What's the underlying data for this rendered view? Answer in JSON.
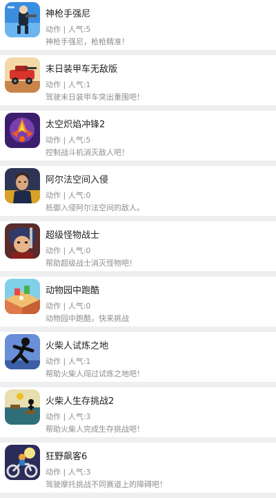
{
  "games": [
    {
      "title": "神枪手强尼",
      "category": "动作",
      "popularity_label": "人气",
      "popularity": "5",
      "description": "神枪手强尼，枪枪精准！",
      "icon": "gunslinger-game-icon"
    },
    {
      "title": "末日装甲车无敌版",
      "category": "动作",
      "popularity_label": "人气",
      "popularity": "1",
      "description": "驾驶末日装甲车突出重围吧！",
      "icon": "armored-car-game-icon"
    },
    {
      "title": "太空炽焰冲锋2",
      "category": "动作",
      "popularity_label": "人气",
      "popularity": "5",
      "description": "控制战斗机消灭敌人吧！",
      "icon": "space-fighter-game-icon"
    },
    {
      "title": "阿尔法空间入侵",
      "category": "动作",
      "popularity_label": "人气",
      "popularity": "0",
      "description": "抵御入侵阿尔法空间的敌人。",
      "icon": "alpha-invasion-game-icon"
    },
    {
      "title": "超级怪物战士",
      "category": "动作",
      "popularity_label": "人气",
      "popularity": "0",
      "description": "帮助超级战士消灭怪物吧！",
      "icon": "monster-warrior-game-icon"
    },
    {
      "title": "动物园中跑酷",
      "category": "动作",
      "popularity_label": "人气",
      "popularity": "0",
      "description": "动物园中跑酷，快来挑战",
      "icon": "zoo-parkour-game-icon"
    },
    {
      "title": "火柴人试炼之地",
      "category": "动作",
      "popularity_label": "人气",
      "popularity": "1",
      "description": "帮助火柴人闯过试炼之地吧！",
      "icon": "stickman-trial-game-icon"
    },
    {
      "title": "火柴人生存挑战2",
      "category": "动作",
      "popularity_label": "人气",
      "popularity": "3",
      "description": "帮助火柴人完成生存挑战吧！",
      "icon": "stickman-survival-game-icon"
    },
    {
      "title": "狂野飙客6",
      "category": "动作",
      "popularity_label": "人气",
      "popularity": "3",
      "description": "驾驶摩托挑战不同赛道上的障碍吧！",
      "icon": "wild-biker-game-icon"
    }
  ]
}
